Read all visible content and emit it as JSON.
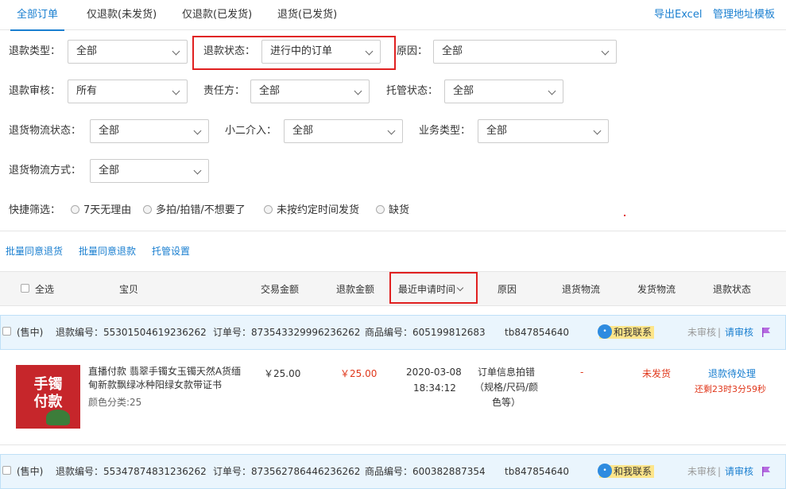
{
  "tabs": [
    "全部订单",
    "仅退款(未发货)",
    "仅退款(已发货)",
    "退货(已发货)"
  ],
  "toplinks": [
    "导出Excel",
    "管理地址模板"
  ],
  "filters": {
    "refund_type": {
      "label": "退款类型：",
      "value": "全部"
    },
    "refund_status": {
      "label": "退款状态：",
      "value": "进行中的订单"
    },
    "reason": {
      "label": "原因：",
      "value": "全部"
    },
    "refund_review": {
      "label": "退款审核：",
      "value": "所有"
    },
    "responsible": {
      "label": "责任方：",
      "value": "全部"
    },
    "custody_status": {
      "label": "托管状态：",
      "value": "全部"
    },
    "return_logistics_status": {
      "label": "退货物流状态：",
      "value": "全部"
    },
    "xiaoer": {
      "label": "小二介入：",
      "value": "全部"
    },
    "business_type": {
      "label": "业务类型：",
      "value": "全部"
    },
    "return_logistics_method": {
      "label": "退货物流方式：",
      "value": "全部"
    }
  },
  "quick": {
    "label": "快捷筛选：",
    "options": [
      "7天无理由",
      "多拍/拍错/不想要了",
      "未按约定时间发货",
      "缺货"
    ]
  },
  "batch": [
    "批量同意退货",
    "批量同意退款",
    "托管设置"
  ],
  "columns": {
    "select_all": "全选",
    "item": "宝贝",
    "trade_amount": "交易金额",
    "refund_amount": "退款金额",
    "latest_time": "最近申请时间",
    "reason": "原因",
    "return_logistics": "退货物流",
    "ship_logistics": "发货物流",
    "refund_status": "退款状态"
  },
  "orders": [
    {
      "status_tag": "(售中)",
      "refund_no": "退款编号：55301504619236262",
      "order_no": "订单号：873543329996236262",
      "product_no": "商品编号：605199812683",
      "buyer": "tb847854640",
      "contact": "和我联系",
      "review": "未审核",
      "review_link": "请审核",
      "item_title": "直播付款 翡翠手镯女玉镯天然A货缅甸新款飘绿冰种阳绿女款带证书",
      "item_sku": "颜色分类:25",
      "thumb_text": [
        "手镯",
        "付款"
      ],
      "trade_amount": "￥25.00",
      "refund_amount": "￥25.00",
      "date": "2020-03-08",
      "time": "18:34:12",
      "reason_text": "订单信息拍错（规格/尺码/颜色等）",
      "return_logistics": "-",
      "ship_logistics": "未发货",
      "refund_status": "退款待处理",
      "countdown": "还剩23时3分59秒"
    },
    {
      "status_tag": "(售中)",
      "refund_no": "退款编号：55347874831236262",
      "order_no": "订单号：873562786446236262",
      "product_no": "商品编号：600382887354",
      "buyer": "tb847854640",
      "contact": "和我联系",
      "review": "未审核",
      "review_link": "请审核"
    }
  ],
  "colors": {
    "accent": "#1a7fd0",
    "highlight": "#e02020",
    "price": "#e0371b",
    "header_bg": "#eaf5fd"
  }
}
